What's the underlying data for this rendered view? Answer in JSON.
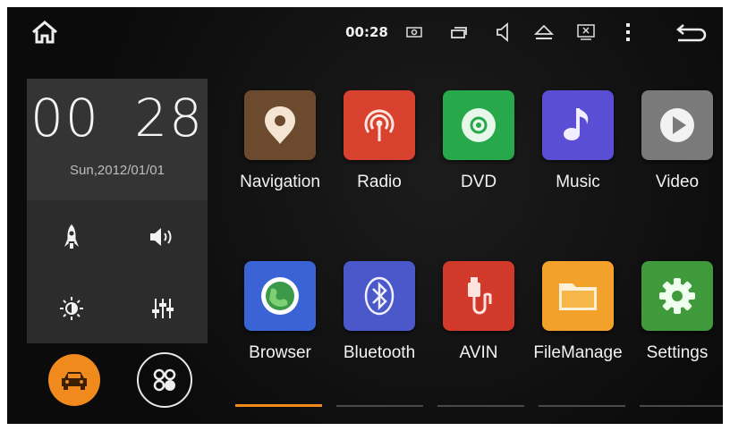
{
  "statusbar": {
    "clock": "00:28",
    "icons": [
      "home-icon",
      "screenshot-icon",
      "recent-apps-icon",
      "volume-icon",
      "eject-icon",
      "close-window-icon",
      "menu-dots-icon",
      "back-icon"
    ]
  },
  "clock_widget": {
    "time": "00 28",
    "date": "Sun,2012/01/01"
  },
  "quick_controls": [
    "rocket-icon",
    "volume-icon",
    "brightness-icon",
    "equalizer-icon"
  ],
  "bottom_buttons": [
    "car-icon",
    "apps-grid-icon"
  ],
  "apps": [
    {
      "label": "Navigation",
      "icon": "map-pin-icon",
      "color": "#6b4a2e"
    },
    {
      "label": "Radio",
      "icon": "radio-antenna-icon",
      "color": "#d9412f"
    },
    {
      "label": "DVD",
      "icon": "disc-icon",
      "color": "#27a84a"
    },
    {
      "label": "Music",
      "icon": "music-note-icon",
      "color": "#5a4fd4"
    },
    {
      "label": "Video",
      "icon": "play-icon",
      "color": "#7a7a7a"
    },
    {
      "label": "Browser",
      "icon": "globe-icon",
      "color": "#3a63d6"
    },
    {
      "label": "Bluetooth",
      "icon": "bluetooth-icon",
      "color": "#4b58c9"
    },
    {
      "label": "AVIN",
      "icon": "av-cable-icon",
      "color": "#d13a2b"
    },
    {
      "label": "FileManage",
      "icon": "folder-icon",
      "color": "#f3a12a"
    },
    {
      "label": "Settings",
      "icon": "gear-icon",
      "color": "#3f9a3c"
    }
  ],
  "pager": {
    "pages": 5,
    "active": 0
  },
  "colors": {
    "accent": "#f08a1c",
    "background": "#0d0d0d",
    "panel": "#343434"
  }
}
